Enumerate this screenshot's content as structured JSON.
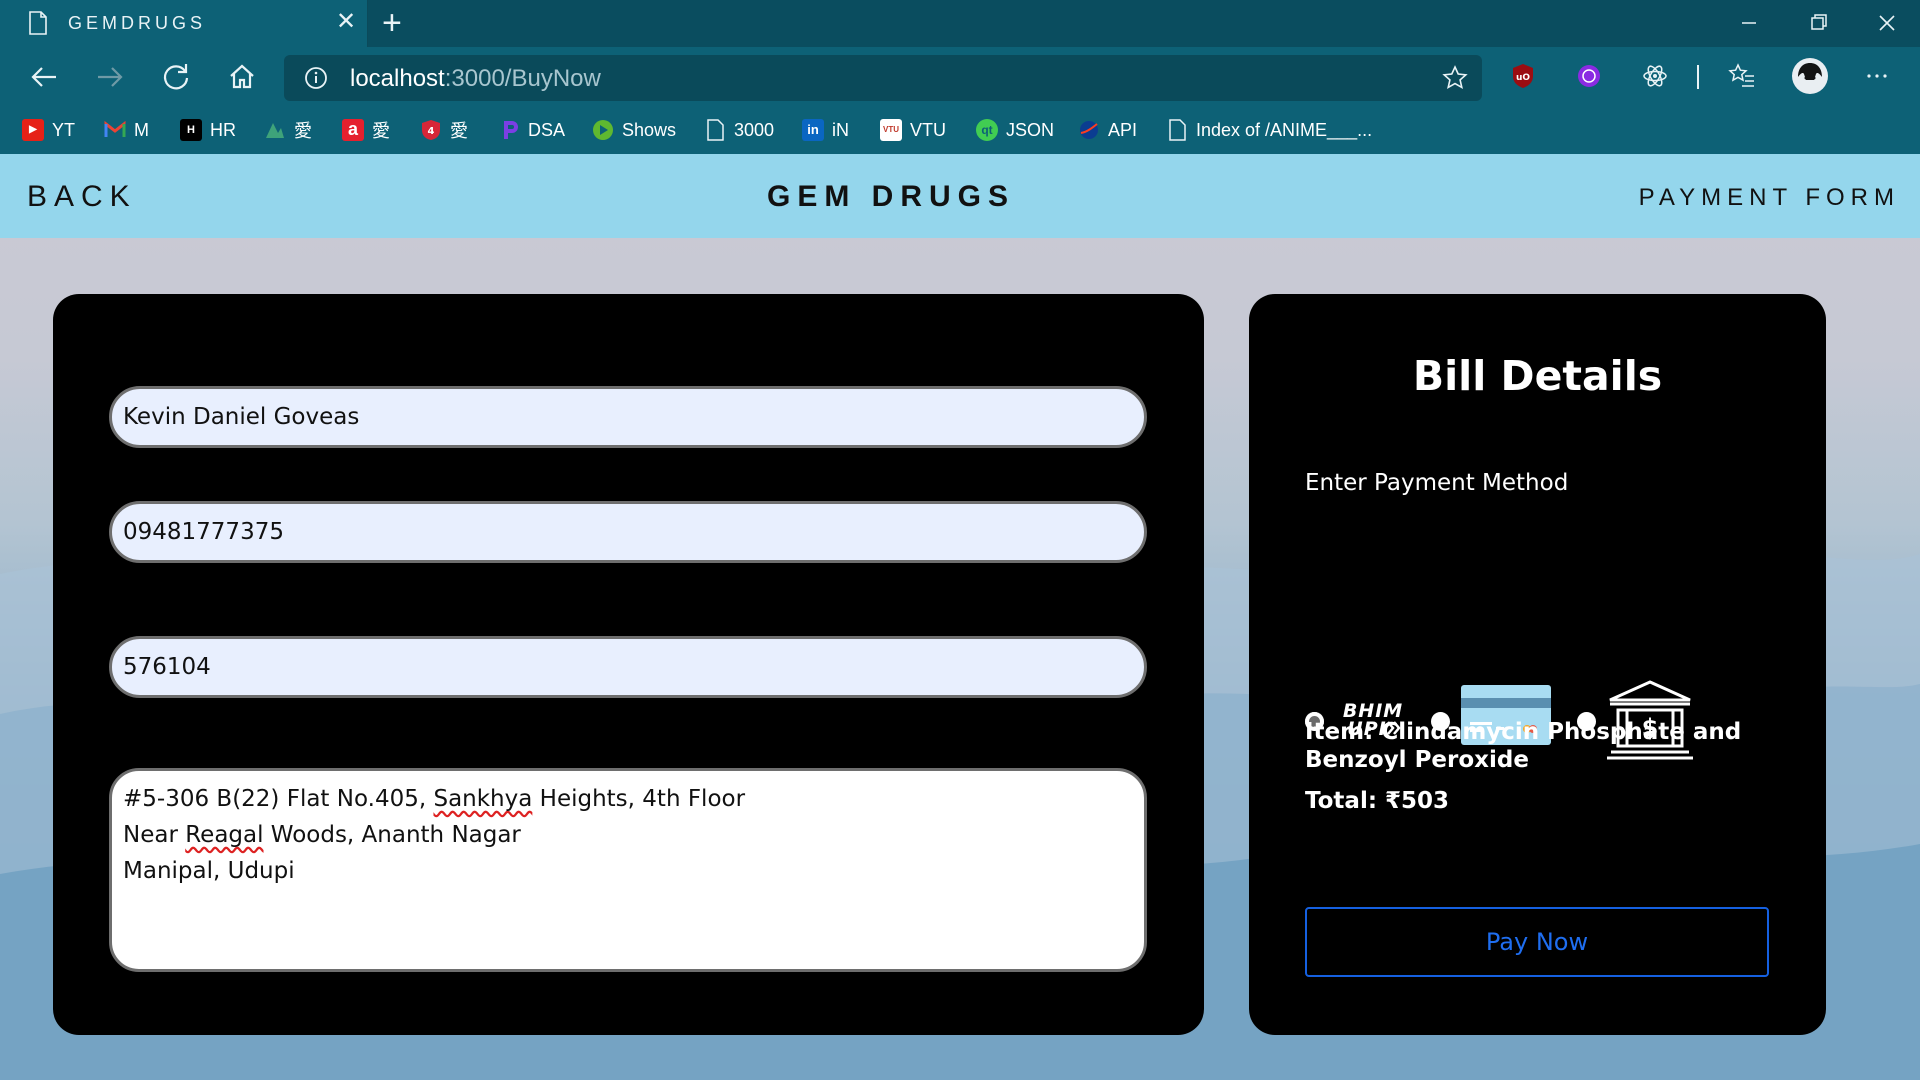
{
  "browser": {
    "tab_title": "GEMDRUGS",
    "url_host": "localhost",
    "url_rest": ":3000/BuyNow",
    "bookmarks": [
      {
        "label": "YT",
        "icon": "youtube-icon"
      },
      {
        "label": "M",
        "icon": "gmail-icon"
      },
      {
        "label": "HR",
        "icon": "hackerrank-icon"
      },
      {
        "label": "愛",
        "icon": "anime-icon"
      },
      {
        "label": "愛",
        "icon": "anime-red-icon"
      },
      {
        "label": "愛",
        "icon": "anime-shield-icon"
      },
      {
        "label": "DSA",
        "icon": "dsa-icon"
      },
      {
        "label": "Shows",
        "icon": "play-icon"
      },
      {
        "label": "3000",
        "icon": "page-icon"
      },
      {
        "label": "iN",
        "icon": "linkedin-icon"
      },
      {
        "label": "VTU",
        "icon": "vtu-icon"
      },
      {
        "label": "JSON",
        "icon": "qt-icon"
      },
      {
        "label": "API",
        "icon": "nasa-icon"
      },
      {
        "label": "Index of /ANIME___...",
        "icon": "page-icon"
      }
    ]
  },
  "navbar": {
    "back": "BACK",
    "brand": "GEM DRUGS",
    "right": "PAYMENT FORM"
  },
  "form": {
    "name": "Kevin Daniel Goveas",
    "phone": "09481777375",
    "pincode": "576104",
    "address_line1_a": "#5-306 B(22) Flat No.405, ",
    "address_line1_b": "Sankhya",
    "address_line1_c": " Heights, 4th Floor",
    "address_line2_a": "Near ",
    "address_line2_b": "Reagal",
    "address_line2_c": " Woods, Ananth Nagar",
    "address_line3": "Manipal, Udupi"
  },
  "bill": {
    "title": "Bill Details",
    "payment_label": "Enter Payment Method",
    "methods": [
      {
        "name": "BHIM UPI",
        "icon": "bhim-upi-icon",
        "selected": true
      },
      {
        "name": "Card",
        "icon": "credit-card-icon",
        "selected": false
      },
      {
        "name": "Net Banking",
        "icon": "bank-icon",
        "selected": false
      }
    ],
    "item": "Item: Clindamycin Phosphate and Benzoyl Peroxide",
    "total": "Total: ₹503",
    "pay_button": "Pay Now"
  },
  "colors": {
    "navbar_bg": "#94d6ec",
    "card_bg": "#000000",
    "input_bg": "#e8effe",
    "pay_button_accent": "#1f6ef0",
    "browser_chrome": "#0d6176"
  }
}
